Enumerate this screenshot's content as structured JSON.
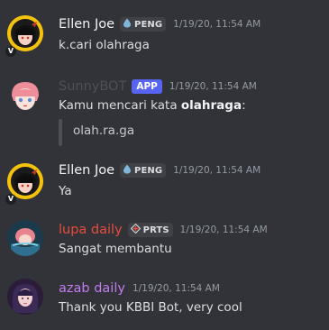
{
  "messages": [
    {
      "username": "Ellen Joe",
      "username_color": "#f2f3f5",
      "tag": "PENG",
      "timestamp": "1/19/20, 11:54 AM",
      "text": "k.cari olahraga"
    },
    {
      "username": "SunnyBOT",
      "username_color": "#4e5058",
      "app_tag": "APP",
      "timestamp": "1/19/20, 11:54 AM",
      "text_prefix": "Kamu mencari kata ",
      "text_bold": "olahraga",
      "text_suffix": ":",
      "embed_text": "olah.ra.ga"
    },
    {
      "username": "Ellen Joe",
      "username_color": "#f2f3f5",
      "tag": "PENG",
      "timestamp": "1/19/20, 11:54 AM",
      "text": "Ya"
    },
    {
      "username": "lupa daily",
      "username_color": "#e74c3c",
      "tag": "PRTS",
      "timestamp": "1/19/20, 11:54 AM",
      "text": "Sangat membantu"
    },
    {
      "username": "azab daily",
      "username_color": "#c27cee",
      "timestamp": "1/19/20, 11:54 AM",
      "text": "Thank you KBBI Bot, very cool"
    }
  ],
  "colors": {
    "background": "#313338",
    "text": "#dbdee1",
    "timestamp": "#949ba4",
    "tag_bg": "#3f4147",
    "app_tag_bg": "#5865f2",
    "embed_bar": "#4e5058"
  },
  "icons": {
    "peng_tag_icon": "droplet-icon",
    "prts_tag_icon": "diamond-cross-icon",
    "avatar_badge": "v-badge-icon"
  }
}
